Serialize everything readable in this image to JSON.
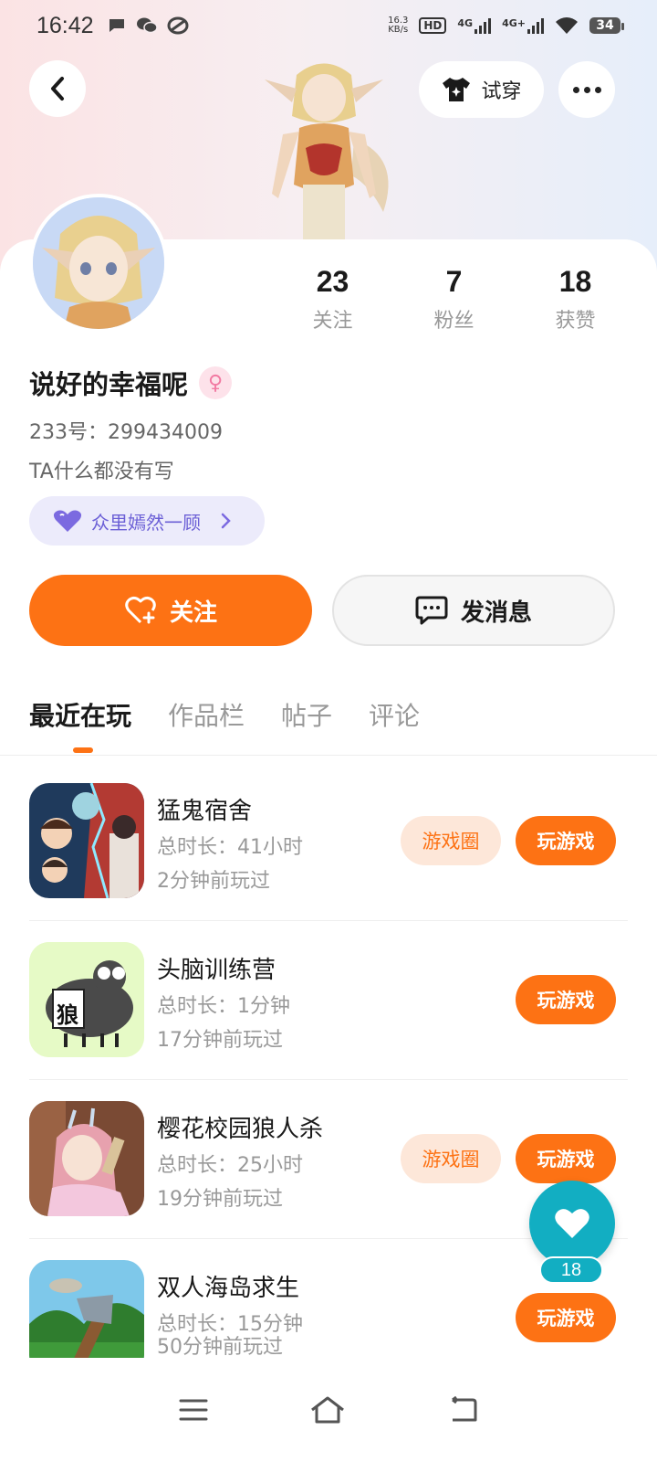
{
  "status_bar": {
    "time": "16:42",
    "net_speed_value": "16.3",
    "net_speed_unit": "KB/s",
    "hd_label": "HD",
    "sim1_label": "4G",
    "sim2_label": "4G+",
    "battery": "34"
  },
  "header": {
    "try_on_label": "试穿"
  },
  "profile": {
    "stats": [
      {
        "value": "23",
        "label": "关注"
      },
      {
        "value": "7",
        "label": "粉丝"
      },
      {
        "value": "18",
        "label": "获赞"
      }
    ],
    "nickname": "说好的幸福呢",
    "gender_symbol": "♀",
    "uid": "233号：299434009",
    "bio": "TA什么都没有写",
    "tag_label": "众里嫣然一顾"
  },
  "actions": {
    "follow_label": "关注",
    "message_label": "发消息"
  },
  "tabs": [
    {
      "label": "最近在玩",
      "active": true
    },
    {
      "label": "作品栏",
      "active": false
    },
    {
      "label": "帖子",
      "active": false
    },
    {
      "label": "评论",
      "active": false
    }
  ],
  "games": [
    {
      "name": "猛鬼宿舍",
      "duration": "总时长：41小时",
      "last_played": "2分钟前玩过",
      "circle_label": "游戏圈",
      "play_label": "玩游戏"
    },
    {
      "name": "头脑训练营",
      "duration": "总时长：1分钟",
      "last_played": "17分钟前玩过",
      "play_label": "玩游戏",
      "icon_text": "狼"
    },
    {
      "name": "樱花校园狼人杀",
      "duration": "总时长：25小时",
      "last_played": "19分钟前玩过",
      "circle_label": "游戏圈",
      "play_label": "玩游戏"
    },
    {
      "name": "双人海岛求生",
      "duration": "总时长：15分钟",
      "last_played": "50分钟前玩过",
      "play_label": "玩游戏"
    }
  ],
  "like_fab": {
    "count": "18"
  },
  "colors": {
    "accent_orange": "#fd7214",
    "like_teal": "#12aec2",
    "tag_purple": "#6b5fd6"
  },
  "icons": [
    "signal-icon",
    "back-icon",
    "tshirt-sparkle-icon",
    "more-dots-icon",
    "female-icon",
    "heart-icon",
    "chevron-right-icon",
    "heart-plus-icon",
    "chat-bubble-icon",
    "menu-icon",
    "home-icon",
    "back-nav-icon"
  ]
}
